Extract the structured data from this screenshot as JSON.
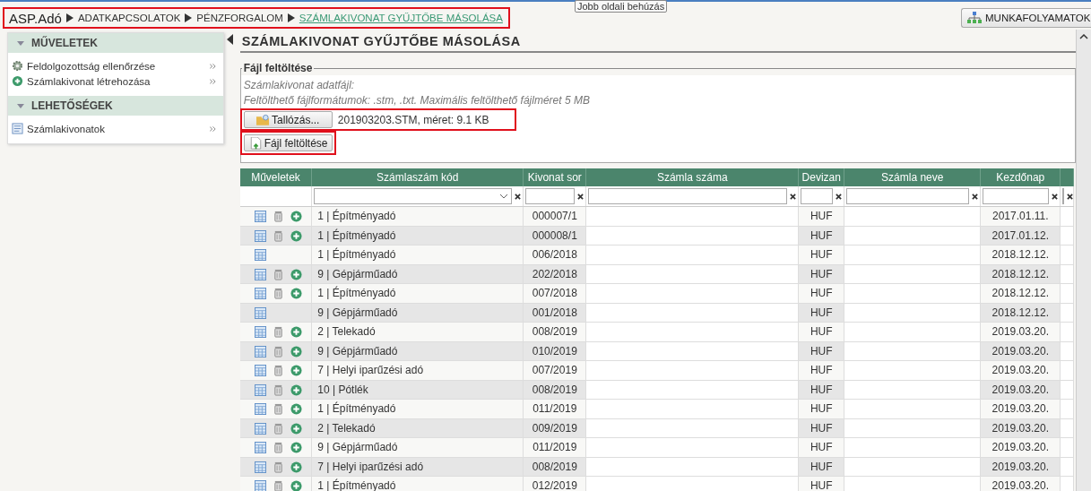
{
  "breadcrumb": {
    "highlighted": true,
    "items": [
      {
        "label": "ASP.Adó",
        "kind": "root"
      },
      {
        "label": "ADATKAPCSOLATOK",
        "kind": "link"
      },
      {
        "label": "PÉNZFORGALOM",
        "kind": "link"
      },
      {
        "label": "SZÁMLAKIVONAT GYŰJTŐBE MÁSOLÁSA",
        "kind": "current"
      }
    ]
  },
  "tooltip": "Jobb oldali behúzás",
  "workflow_button": "MUNKAFOLYAMATOK",
  "sidebar": [
    {
      "title": "MŰVELETEK",
      "items": [
        {
          "label": "Feldolgozottság ellenőrzése",
          "kind": "gear"
        },
        {
          "label": "Számlakivonat létrehozása",
          "kind": "add"
        }
      ]
    },
    {
      "title": "LEHETŐSÉGEK",
      "items": [
        {
          "label": "Számlakivonatok",
          "kind": "list"
        }
      ]
    }
  ],
  "page_title": "SZÁMLAKIVONAT GYŰJTŐBE MÁSOLÁSA",
  "upload": {
    "legend": "Fájl feltöltése",
    "field_label": "Számlakivonat adatfájl:",
    "hint": "Feltölthető fájlformátumok: .stm, .txt. Maximális feltölthető fájlméret 5 MB",
    "browse_button": "Tallózás...",
    "file_info": "201903203.STM, méret: 9.1 KB",
    "file_row_highlighted": true,
    "upload_button": "Fájl feltöltése",
    "upload_highlighted": true
  },
  "table": {
    "columns": [
      {
        "label": "Műveletek",
        "kind": "actions"
      },
      {
        "label": "Számlaszám kód",
        "kind": "code"
      },
      {
        "label": "Kivonat sor",
        "kind": "statement"
      },
      {
        "label": "Számla száma",
        "kind": "blank"
      },
      {
        "label": "Devizan",
        "kind": "currency"
      },
      {
        "label": "Számla neve",
        "kind": "blank"
      },
      {
        "label": "Kezdőnap",
        "kind": "date"
      },
      {
        "kind": "blank"
      }
    ],
    "rows": [
      {
        "actions": [
          {
            "kind": "view"
          },
          {
            "kind": "delete"
          },
          {
            "kind": "add"
          }
        ],
        "code": "1 | Építményadó",
        "statement": "000007/1",
        "currency": "HUF",
        "date": "2017.01.11."
      },
      {
        "actions": [
          {
            "kind": "view"
          },
          {
            "kind": "delete"
          },
          {
            "kind": "add"
          }
        ],
        "code": "1 | Építményadó",
        "statement": "000008/1",
        "currency": "HUF",
        "date": "2017.01.12."
      },
      {
        "actions": [
          {
            "kind": "view"
          }
        ],
        "code": "1 | Építményadó",
        "statement": "006/2018",
        "currency": "HUF",
        "date": "2018.12.12."
      },
      {
        "actions": [
          {
            "kind": "view"
          },
          {
            "kind": "delete"
          },
          {
            "kind": "add"
          }
        ],
        "code": "9 | Gépjárműadó",
        "statement": "202/2018",
        "currency": "HUF",
        "date": "2018.12.12."
      },
      {
        "actions": [
          {
            "kind": "view"
          },
          {
            "kind": "delete"
          },
          {
            "kind": "add"
          }
        ],
        "code": "1 | Építményadó",
        "statement": "007/2018",
        "currency": "HUF",
        "date": "2018.12.12."
      },
      {
        "actions": [
          {
            "kind": "view"
          }
        ],
        "code": "9 | Gépjárműadó",
        "statement": "001/2018",
        "currency": "HUF",
        "date": "2018.12.12."
      },
      {
        "actions": [
          {
            "kind": "view"
          },
          {
            "kind": "delete"
          },
          {
            "kind": "add"
          }
        ],
        "code": "2 | Telekadó",
        "statement": "008/2019",
        "currency": "HUF",
        "date": "2019.03.20."
      },
      {
        "actions": [
          {
            "kind": "view"
          },
          {
            "kind": "delete"
          },
          {
            "kind": "add"
          }
        ],
        "code": "9 | Gépjárműadó",
        "statement": "010/2019",
        "currency": "HUF",
        "date": "2019.03.20."
      },
      {
        "actions": [
          {
            "kind": "view"
          },
          {
            "kind": "delete"
          },
          {
            "kind": "add"
          }
        ],
        "code": "7 | Helyi iparűzési adó",
        "statement": "007/2019",
        "currency": "HUF",
        "date": "2019.03.20."
      },
      {
        "actions": [
          {
            "kind": "view"
          },
          {
            "kind": "delete"
          },
          {
            "kind": "add"
          }
        ],
        "code": "10 | Pótlék",
        "statement": "008/2019",
        "currency": "HUF",
        "date": "2019.03.20."
      },
      {
        "actions": [
          {
            "kind": "view"
          },
          {
            "kind": "delete"
          },
          {
            "kind": "add"
          }
        ],
        "code": "1 | Építményadó",
        "statement": "011/2019",
        "currency": "HUF",
        "date": "2019.03.20."
      },
      {
        "actions": [
          {
            "kind": "view"
          },
          {
            "kind": "delete"
          },
          {
            "kind": "add"
          }
        ],
        "code": "2 | Telekadó",
        "statement": "009/2019",
        "currency": "HUF",
        "date": "2019.03.20."
      },
      {
        "actions": [
          {
            "kind": "view"
          },
          {
            "kind": "delete"
          },
          {
            "kind": "add"
          }
        ],
        "code": "9 | Gépjárműadó",
        "statement": "011/2019",
        "currency": "HUF",
        "date": "2019.03.20."
      },
      {
        "actions": [
          {
            "kind": "view"
          },
          {
            "kind": "delete"
          },
          {
            "kind": "add"
          }
        ],
        "code": "7 | Helyi iparűzési adó",
        "statement": "008/2019",
        "currency": "HUF",
        "date": "2019.03.20."
      },
      {
        "actions": [
          {
            "kind": "view"
          },
          {
            "kind": "delete"
          },
          {
            "kind": "add"
          }
        ],
        "code": "1 | Építményadó",
        "statement": "012/2019",
        "currency": "HUF",
        "date": "2019.03.20."
      }
    ]
  }
}
